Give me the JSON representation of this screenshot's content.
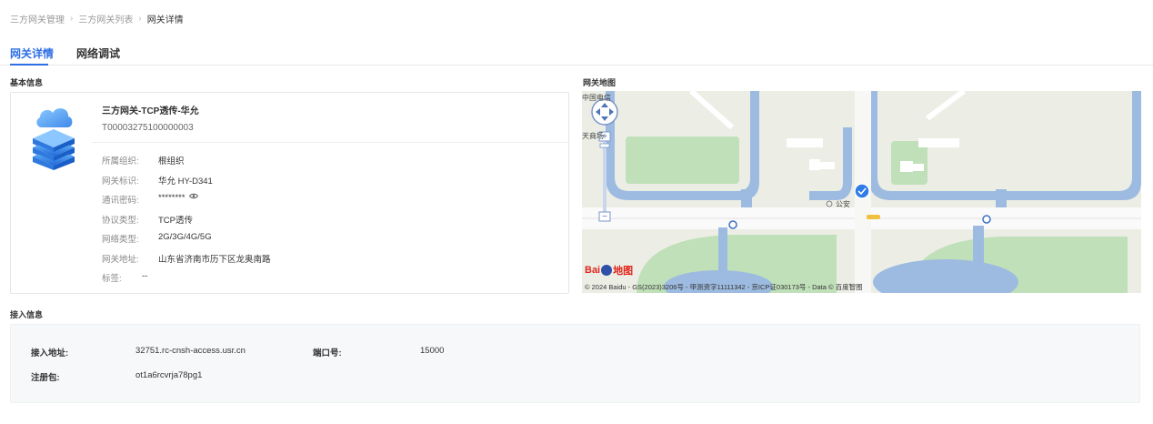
{
  "breadcrumb": {
    "items": [
      "三方网关管理",
      "三方网关列表"
    ],
    "current": "网关详情"
  },
  "tabs": [
    {
      "label": "网关详情",
      "active": true
    },
    {
      "label": "网络调试",
      "active": false
    }
  ],
  "basic_info": {
    "title": "基本信息",
    "device_name": "三方网关-TCP透传-华允",
    "serial": "T00003275100000003",
    "rows": [
      {
        "label": "所属组织:",
        "value": "根组织"
      },
      {
        "label": "网关标识:",
        "value": "华允 HY-D341"
      },
      {
        "label": "通讯密码:",
        "value": "********"
      },
      {
        "label": "协议类型:",
        "value": "TCP透传"
      },
      {
        "label": "网络类型:",
        "value": "2G/3G/4G/5G"
      },
      {
        "label": "网关地址:",
        "value": "山东省济南市历下区龙奥南路"
      },
      {
        "label": "标签:",
        "value": "--"
      }
    ]
  },
  "map": {
    "title": "网关地图",
    "poi_labels": [
      "中国电信",
      "天商场",
      "公安"
    ],
    "logo_text": "Bai",
    "logo_tail": "地图",
    "copyright": "© 2024 Baidu - GS(2023)3206号 - 甲测资字11111342 - 京ICP证030173号 - Data © 百度智图"
  },
  "access_info": {
    "title": "接入信息",
    "address_label": "接入地址:",
    "address_value": "32751.rc-cnsh-access.usr.cn",
    "port_label": "端口号:",
    "port_value": "15000",
    "register_label": "注册包:",
    "register_value": "ot1a6rcvrja78pg1"
  },
  "colors": {
    "accent": "#2f6fe4",
    "map_water": "#8fb0d9",
    "map_green": "#b9dcb4"
  }
}
